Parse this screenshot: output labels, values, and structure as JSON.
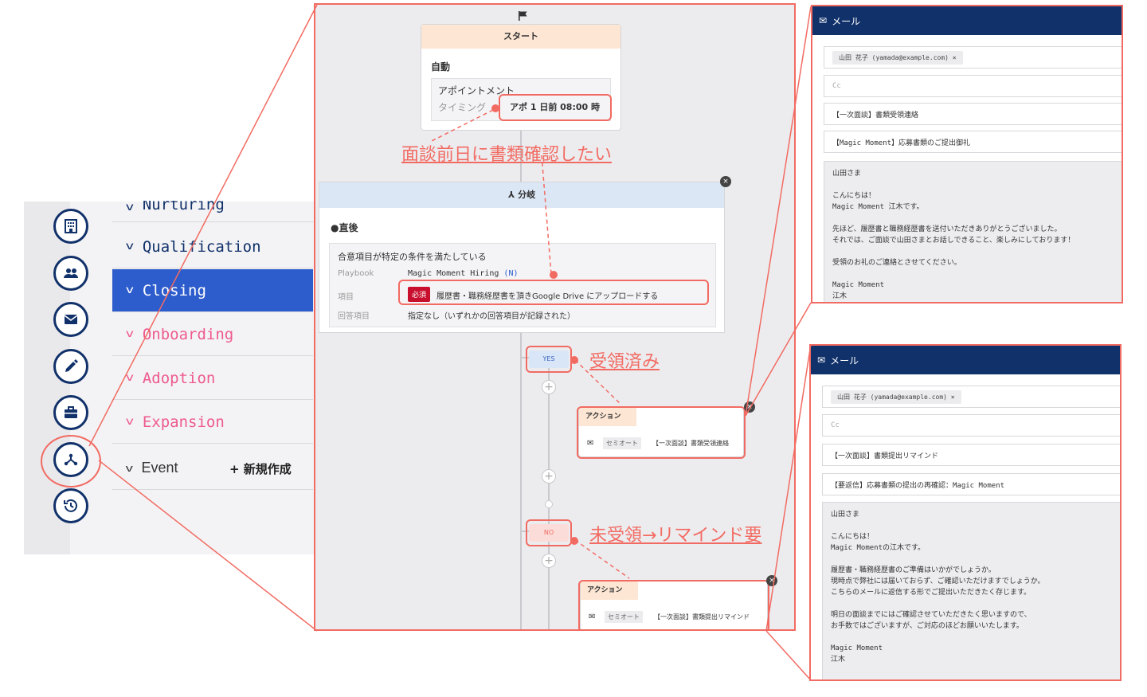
{
  "left_panel": {
    "stages": [
      {
        "label": "Nurturing",
        "style": "nav"
      },
      {
        "label": "Qualification",
        "style": "nav"
      },
      {
        "label": "Closing",
        "style": "active"
      },
      {
        "label": "Onboarding",
        "style": "pink"
      },
      {
        "label": "Adoption",
        "style": "pink"
      },
      {
        "label": "Expansion",
        "style": "pink"
      },
      {
        "label": "Event",
        "style": "plain"
      }
    ],
    "new_button": "+ 新規作成",
    "rail_icons": [
      "building-icon",
      "people-icon",
      "mail-icon",
      "pencil-icon",
      "briefcase-icon",
      "branch-icon",
      "history-icon"
    ]
  },
  "flow": {
    "start": {
      "header": "スタート",
      "auto_label": "自動",
      "appointment_label": "アポイントメント",
      "timing_label": "タイミング",
      "timing_value": "アポ 1 日前 08:00 時"
    },
    "branch": {
      "header": "分岐",
      "timing": "直後",
      "condition_title": "合意項目が特定の条件を満たしている",
      "playbook_label": "Playbook",
      "playbook_value": "Magic Moment Hiring",
      "playbook_suffix": "(N)",
      "item_label": "項目",
      "required_badge": "必須",
      "item_value": "履歴書・職務経歴書を頂きGoogle Drive にアップロードする",
      "answer_label": "回答項目",
      "answer_value": "指定なし（いずれかの回答項目が記録された）"
    },
    "yes_badge": "YES",
    "no_badge": "NO",
    "actions": [
      {
        "header": "アクション",
        "tag": "セミオート",
        "title": "【一次面談】書類受領連絡"
      },
      {
        "header": "アクション",
        "tag": "セミオート",
        "title": "【一次面談】書類提出リマインド"
      }
    ]
  },
  "annotations": {
    "day_before": "面談前日に書類確認したい",
    "received": "受領済み",
    "not_received": "未受領→リマインド要"
  },
  "mail_panels": [
    {
      "title": "メール",
      "to_chip": "山田 花子 (yamada@example.com)",
      "chip_close": "×",
      "cc": "Cc",
      "template_name": "【一次面談】書類受領連絡",
      "subject": "【Magic Moment】応募書類のご提出御礼",
      "body": "山田さま\n\nこんにちは！\nMagic Moment 江木です。\n\n先ほど、履歴書と職務経歴書を送付いただきありがとうございました。\nそれでは、ご面談で山田さまとお話しできること、楽しみにしております！\n\n受領のお礼のご連絡とさせてください。\n\nMagic Moment\n江木"
    },
    {
      "title": "メール",
      "to_chip": "山田 花子 (yamada@example.com)",
      "chip_close": "×",
      "cc": "Cc",
      "template_name": "【一次面談】書類提出リマインド",
      "subject": "【要返信】応募書類の提出の再確認：Magic Moment",
      "body": "山田さま\n\nこんにちは！\nMagic Momentの江木です。\n\n履歴書・職務経歴書のご準備はいかがでしょうか。\n現時点で弊社には届いておらず、ご確認いただけますでしょうか。\nこちらのメールに返信する形でご提出いただきたく存じます。\n\n明日の面談までにはご確認させていただきたく思いますので、\nお手数ではございますが、ご対応のほどお願いいたします。\n\nMagic Moment\n江木"
    }
  ],
  "colors": {
    "accent": "#f26b62",
    "navy": "#11316a",
    "active": "#2d5ccc",
    "pink": "#ee5a8f"
  }
}
